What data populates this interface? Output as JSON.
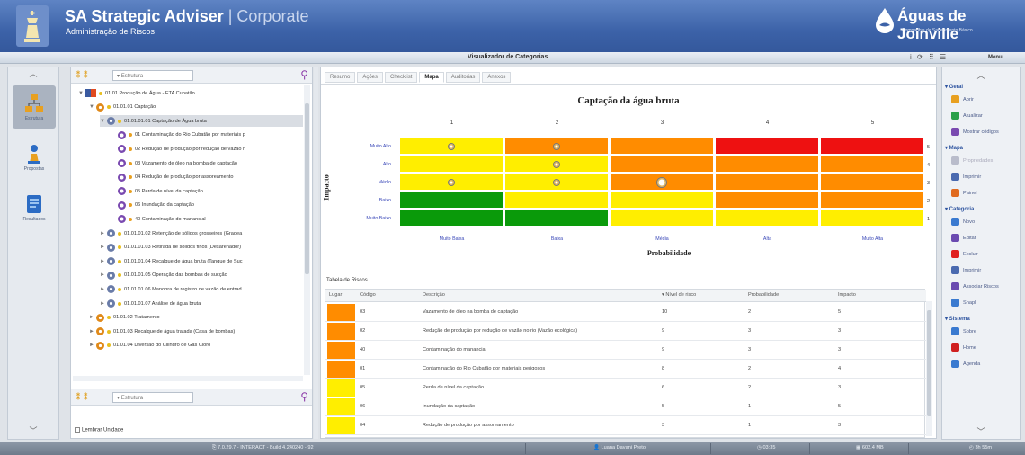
{
  "header": {
    "app_title": "SA Strategic Adviser",
    "app_subtitle": "| Corporate",
    "module": "Administração de Riscos",
    "brand_name": "Águas de Joinville",
    "brand_tagline": "Companhia de Saneamento Básico"
  },
  "toolbar": {
    "view_title": "Visualizador de Categorias",
    "tools": "i ⟳ ⠿ ☰",
    "menu_label": "Menu"
  },
  "left_nav": {
    "items": [
      {
        "label": "Estrutura",
        "icon": "hierarchy-icon"
      },
      {
        "label": "Propostas",
        "icon": "chess-icon"
      },
      {
        "label": "Resultados",
        "icon": "report-icon"
      }
    ]
  },
  "tree_panel": {
    "filter_top": "Estrutura",
    "filter_bottom": "Estrutura",
    "remember_unit": "Lembrar Unidade",
    "nodes": [
      {
        "text": "01.01 Produção de Água - ETA Cubatão",
        "level": 0,
        "arrow": "▼",
        "icon": "plant"
      },
      {
        "text": "01.01.01 Captação",
        "level": 1,
        "arrow": "▼",
        "icon": "gear-o"
      },
      {
        "text": "01.01.01.01 Captação de Água bruta",
        "level": 2,
        "arrow": "▼",
        "icon": "gear",
        "selected": true
      },
      {
        "text": "01 Contaminação do Rio Cubatão por materiais p",
        "level": 3,
        "arrow": "",
        "icon": "risk"
      },
      {
        "text": "02 Redução de produção por redução de vazão n",
        "level": 3,
        "arrow": "",
        "icon": "risk"
      },
      {
        "text": "03 Vazamento de óleo na bomba de captação",
        "level": 3,
        "arrow": "",
        "icon": "risk"
      },
      {
        "text": "04 Redução de produção por assoreamento",
        "level": 3,
        "arrow": "",
        "icon": "risk"
      },
      {
        "text": "05 Perda de nível da captação",
        "level": 3,
        "arrow": "",
        "icon": "risk"
      },
      {
        "text": "06 Inundação da captação",
        "level": 3,
        "arrow": "",
        "icon": "risk"
      },
      {
        "text": "40 Contaminação do manancial",
        "level": 3,
        "arrow": "",
        "icon": "risk"
      },
      {
        "text": "01.01.01.02 Retenção de sólidos grosseiros (Gradea",
        "level": 2,
        "arrow": "►",
        "icon": "gear"
      },
      {
        "text": "01.01.01.03 Retirada de sólidos finos (Desarenador)",
        "level": 2,
        "arrow": "►",
        "icon": "gear"
      },
      {
        "text": "01.01.01.04 Recalque de água bruta (Tanque de Suc",
        "level": 2,
        "arrow": "►",
        "icon": "gear"
      },
      {
        "text": "01.01.01.05 Operação das bombas de sucção",
        "level": 2,
        "arrow": "►",
        "icon": "gear"
      },
      {
        "text": "01.01.01.06 Manobra de registro de vazão de entrad",
        "level": 2,
        "arrow": "►",
        "icon": "gear"
      },
      {
        "text": "01.01.01.07 Análise de água bruta",
        "level": 2,
        "arrow": "►",
        "icon": "gear"
      },
      {
        "text": "01.01.02 Tratamento",
        "level": 1,
        "arrow": "►",
        "icon": "gear-o"
      },
      {
        "text": "01.01.03 Recalque de água tratada (Casa de bombas)",
        "level": 1,
        "arrow": "►",
        "icon": "gear-o"
      },
      {
        "text": "01.01.04 Diversão do Cilindro de Gás Cloro",
        "level": 1,
        "arrow": "►",
        "icon": "gear-o"
      }
    ]
  },
  "tabs": [
    "Resumo",
    "Ações",
    "Checklist",
    "Mapa",
    "Auditorias",
    "Anexos"
  ],
  "active_tab": "Mapa",
  "risk_map": {
    "title": "Captação da água bruta",
    "x_axis_title": "Probabilidade",
    "y_axis_title": "Impacto",
    "x_categories": [
      "Muito Baixa",
      "Baixa",
      "Média",
      "Alta",
      "Muito Alta"
    ],
    "x_numbers": [
      "1",
      "2",
      "3",
      "4",
      "5"
    ],
    "y_categories": [
      "Muito Alto",
      "Alto",
      "Médio",
      "Baixo",
      "Muito Baixo"
    ],
    "y_numbers": [
      "5",
      "4",
      "3",
      "2",
      "1"
    ],
    "colors": {
      "green": "#0a9a0a",
      "yellow": "#ffee00",
      "orange": "#ff8c00",
      "red": "#ee1111"
    },
    "grid": [
      [
        "yellow",
        "orange",
        "orange",
        "red",
        "red"
      ],
      [
        "yellow",
        "yellow",
        "orange",
        "orange",
        "orange"
      ],
      [
        "yellow",
        "yellow",
        "orange",
        "orange",
        "orange"
      ],
      [
        "green",
        "yellow",
        "yellow",
        "orange",
        "orange"
      ],
      [
        "green",
        "green",
        "yellow",
        "yellow",
        "yellow"
      ]
    ],
    "markers": [
      {
        "row": 0,
        "col": 0,
        "big": false
      },
      {
        "row": 0,
        "col": 1,
        "big": false
      },
      {
        "row": 1,
        "col": 1,
        "big": false
      },
      {
        "row": 2,
        "col": 0,
        "big": false
      },
      {
        "row": 2,
        "col": 1,
        "big": false
      },
      {
        "row": 2,
        "col": 2,
        "big": true
      }
    ]
  },
  "risk_table": {
    "title": "Tabela de Riscos",
    "columns": [
      "Lugar",
      "Código",
      "Descrição",
      "▾ Nível de risco",
      "Probabilidade",
      "Impacto"
    ],
    "rows": [
      {
        "lugar_color": "#ff8c00",
        "codigo": "03",
        "descricao": "Vazamento de óleo na bomba de captação",
        "nivel": "10",
        "prob": "2",
        "impacto": "5"
      },
      {
        "lugar_color": "#ff8c00",
        "codigo": "02",
        "descricao": "Redução de produção por redução de vazão no rio (Vazão ecológica)",
        "nivel": "9",
        "prob": "3",
        "impacto": "3"
      },
      {
        "lugar_color": "#ff8c00",
        "codigo": "40",
        "descricao": "Contaminação do manancial",
        "nivel": "9",
        "prob": "3",
        "impacto": "3"
      },
      {
        "lugar_color": "#ff8c00",
        "codigo": "01",
        "descricao": "Contaminação do Rio Cubatão por materiais perigosos",
        "nivel": "8",
        "prob": "2",
        "impacto": "4"
      },
      {
        "lugar_color": "#ffee00",
        "codigo": "05",
        "descricao": "Perda de nível da captação",
        "nivel": "6",
        "prob": "2",
        "impacto": "3"
      },
      {
        "lugar_color": "#ffee00",
        "codigo": "06",
        "descricao": "Inundação da captação",
        "nivel": "5",
        "prob": "1",
        "impacto": "5"
      },
      {
        "lugar_color": "#ffee00",
        "codigo": "04",
        "descricao": "Redução de produção por assoreamento",
        "nivel": "3",
        "prob": "1",
        "impacto": "3"
      }
    ]
  },
  "right_menu": {
    "sections": [
      {
        "title": "▾ Geral",
        "items": [
          {
            "label": "Abrir",
            "color": "#e8a020",
            "disabled": false
          },
          {
            "label": "Atualizar",
            "color": "#2aa04a",
            "disabled": false
          },
          {
            "label": "Mostrar códigos",
            "color": "#7a4ab0",
            "disabled": false
          }
        ]
      },
      {
        "title": "▾ Mapa",
        "items": [
          {
            "label": "Propriedades",
            "color": "#b9bccb",
            "disabled": true
          },
          {
            "label": "Imprimir",
            "color": "#4a6ab0",
            "disabled": false
          },
          {
            "label": "Painel",
            "color": "#e06a20",
            "disabled": false
          }
        ]
      },
      {
        "title": "▾ Categoria",
        "items": [
          {
            "label": "Novo",
            "color": "#3a7ad0",
            "disabled": false
          },
          {
            "label": "Editar",
            "color": "#6a4ab0",
            "disabled": false
          },
          {
            "label": "Excluir",
            "color": "#e02020",
            "disabled": false
          },
          {
            "label": "Imprimir",
            "color": "#4a6ab0",
            "disabled": false
          },
          {
            "label": "Associar Riscos",
            "color": "#6a4ab0",
            "disabled": false
          },
          {
            "label": "Snapl",
            "color": "#3a7ad0",
            "disabled": false
          }
        ]
      },
      {
        "title": "▾ Sistema",
        "items": [
          {
            "label": "Sobre",
            "color": "#3a7ad0",
            "disabled": false
          },
          {
            "label": "Home",
            "color": "#d02020",
            "disabled": false
          },
          {
            "label": "Agenda",
            "color": "#3a7ad0",
            "disabled": false
          }
        ]
      }
    ]
  },
  "status_bar": {
    "version": "7.0.29.7 - INTERACT - Build 4.240240 - 92",
    "user": "Luana Davani Preto",
    "time": "03:35",
    "memory": "602.4 MB",
    "zoom": "3h 55m"
  }
}
